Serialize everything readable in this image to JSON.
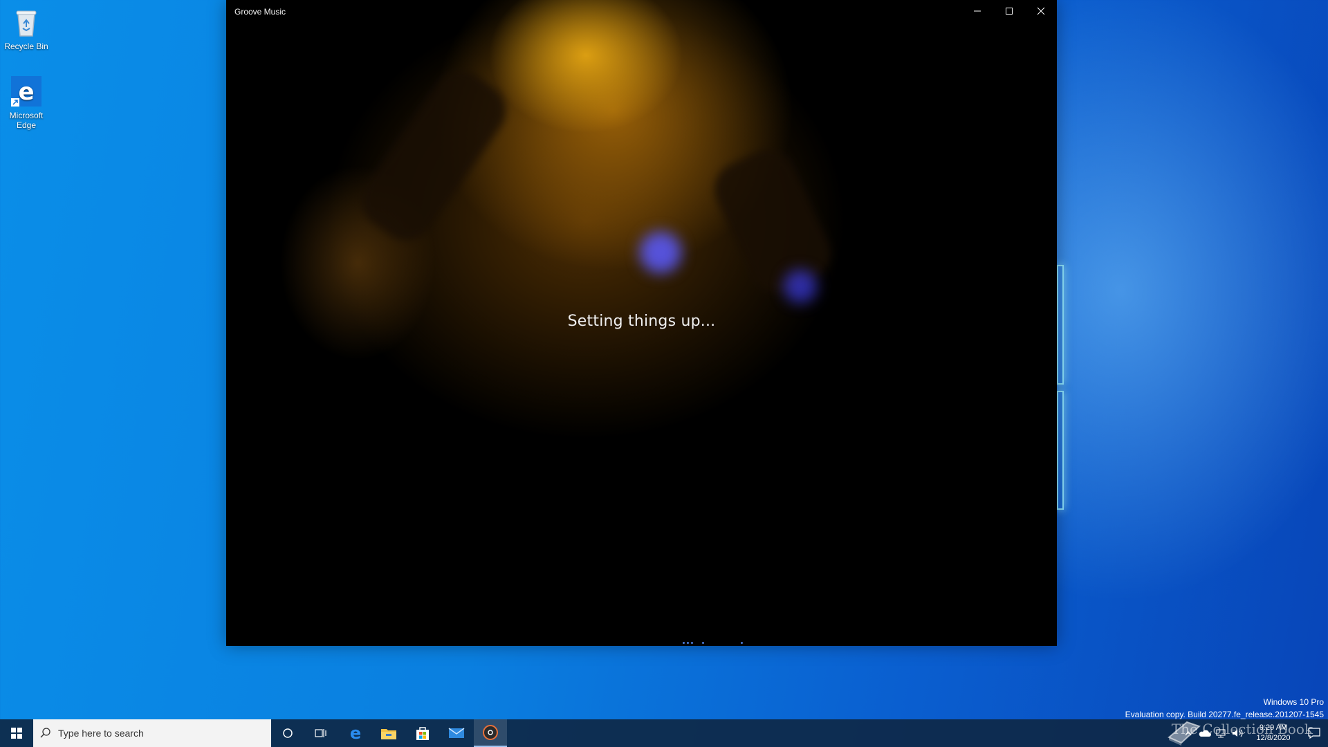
{
  "desktop": {
    "icons": [
      {
        "label": "Recycle Bin",
        "icon": "recycle-bin-icon"
      },
      {
        "label": "Microsoft Edge",
        "icon": "edge-icon"
      }
    ]
  },
  "window": {
    "title": "Groove Music",
    "status": "Setting things up...",
    "controls": {
      "minimize": "minimize-icon",
      "maximize": "maximize-icon",
      "close": "close-icon"
    }
  },
  "watermark": {
    "edition": "Windows 10 Pro",
    "build": "Evaluation copy. Build 20277.fe_release.201207-1545"
  },
  "taskbar": {
    "search_placeholder": "Type here to search",
    "pinned": [
      "cortana-icon",
      "task-view-icon",
      "edge-icon",
      "file-explorer-icon",
      "store-icon",
      "mail-icon",
      "groove-music-icon"
    ],
    "active_app": "Groove Music",
    "clock": {
      "time": "9:29 AM",
      "date": "12/8/2020"
    }
  },
  "overlay_mark": "The Collection Book",
  "colors": {
    "accent": "#0a7fe0",
    "taskbar": "#0e2846",
    "window_bg": "#000000"
  }
}
